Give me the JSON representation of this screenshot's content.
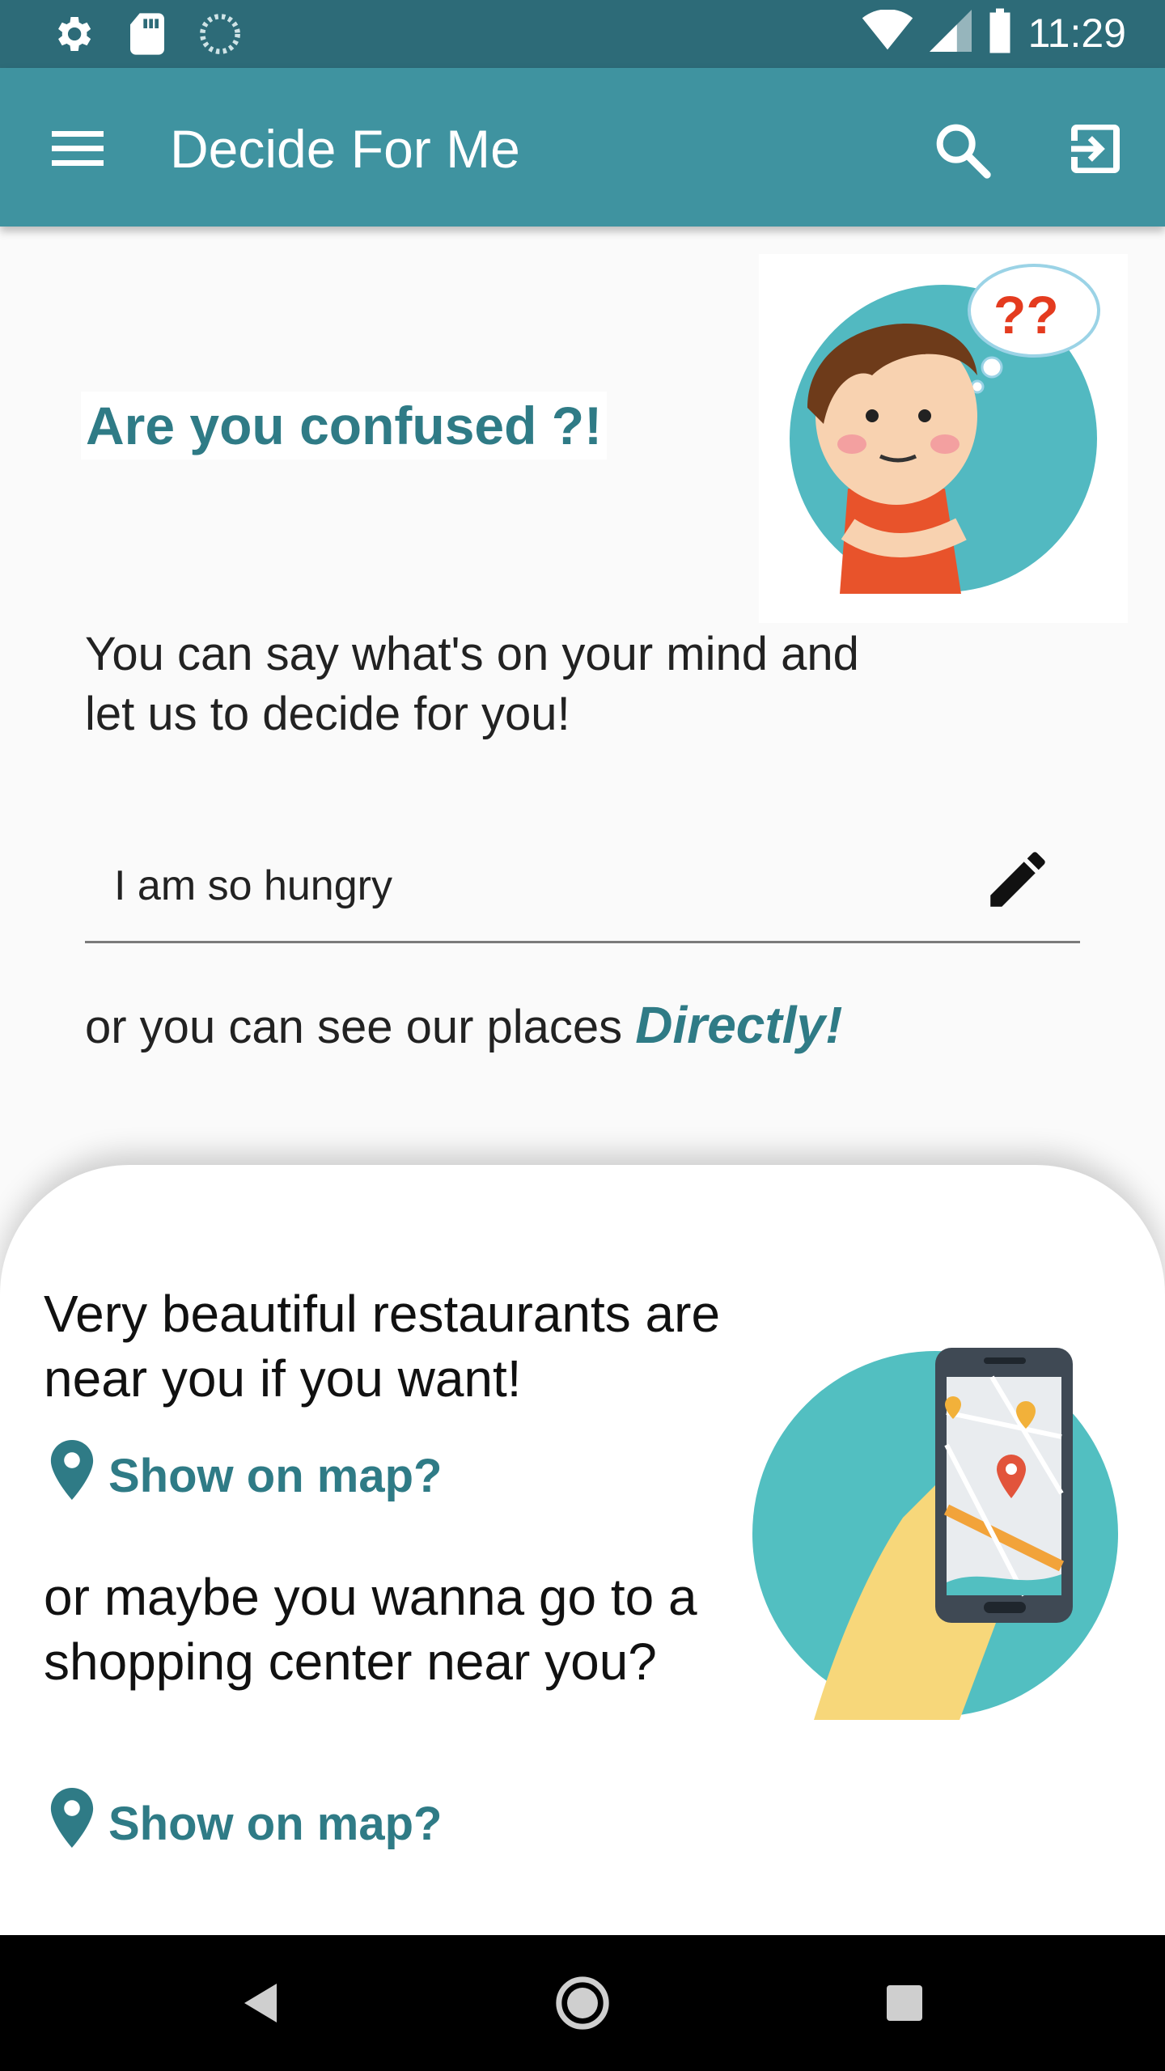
{
  "status_bar": {
    "time": "11:29",
    "icons": [
      "settings-icon",
      "sd-card-icon",
      "sync-icon",
      "wifi-icon",
      "signal-icon",
      "battery-icon"
    ]
  },
  "app_bar": {
    "title": "Decide For Me",
    "icons": [
      "menu-icon",
      "search-icon",
      "exit-icon"
    ],
    "color": "#3f93a0"
  },
  "main": {
    "heading": "Are you confused ?!",
    "intro": "You can say what's on your mind and let us to decide for you!",
    "mind_input": {
      "value": "I am so hungry"
    },
    "directly_prefix": "or you can see our places ",
    "directly_word": "Directly!"
  },
  "bottom_sheet": {
    "restaurants_text": "Very beautiful restaurants are near you if you want!",
    "restaurants_link": "Show on map?",
    "shopping_text": "or maybe you wanna go to a shopping center near you?",
    "shopping_link": "Show on map?"
  },
  "nav_bar": {
    "icons": [
      "back-icon",
      "home-icon",
      "recents-icon"
    ]
  },
  "colors": {
    "accent": "#2f7b86",
    "status_bar": "#2d6b78",
    "nav_bar": "#000000"
  }
}
